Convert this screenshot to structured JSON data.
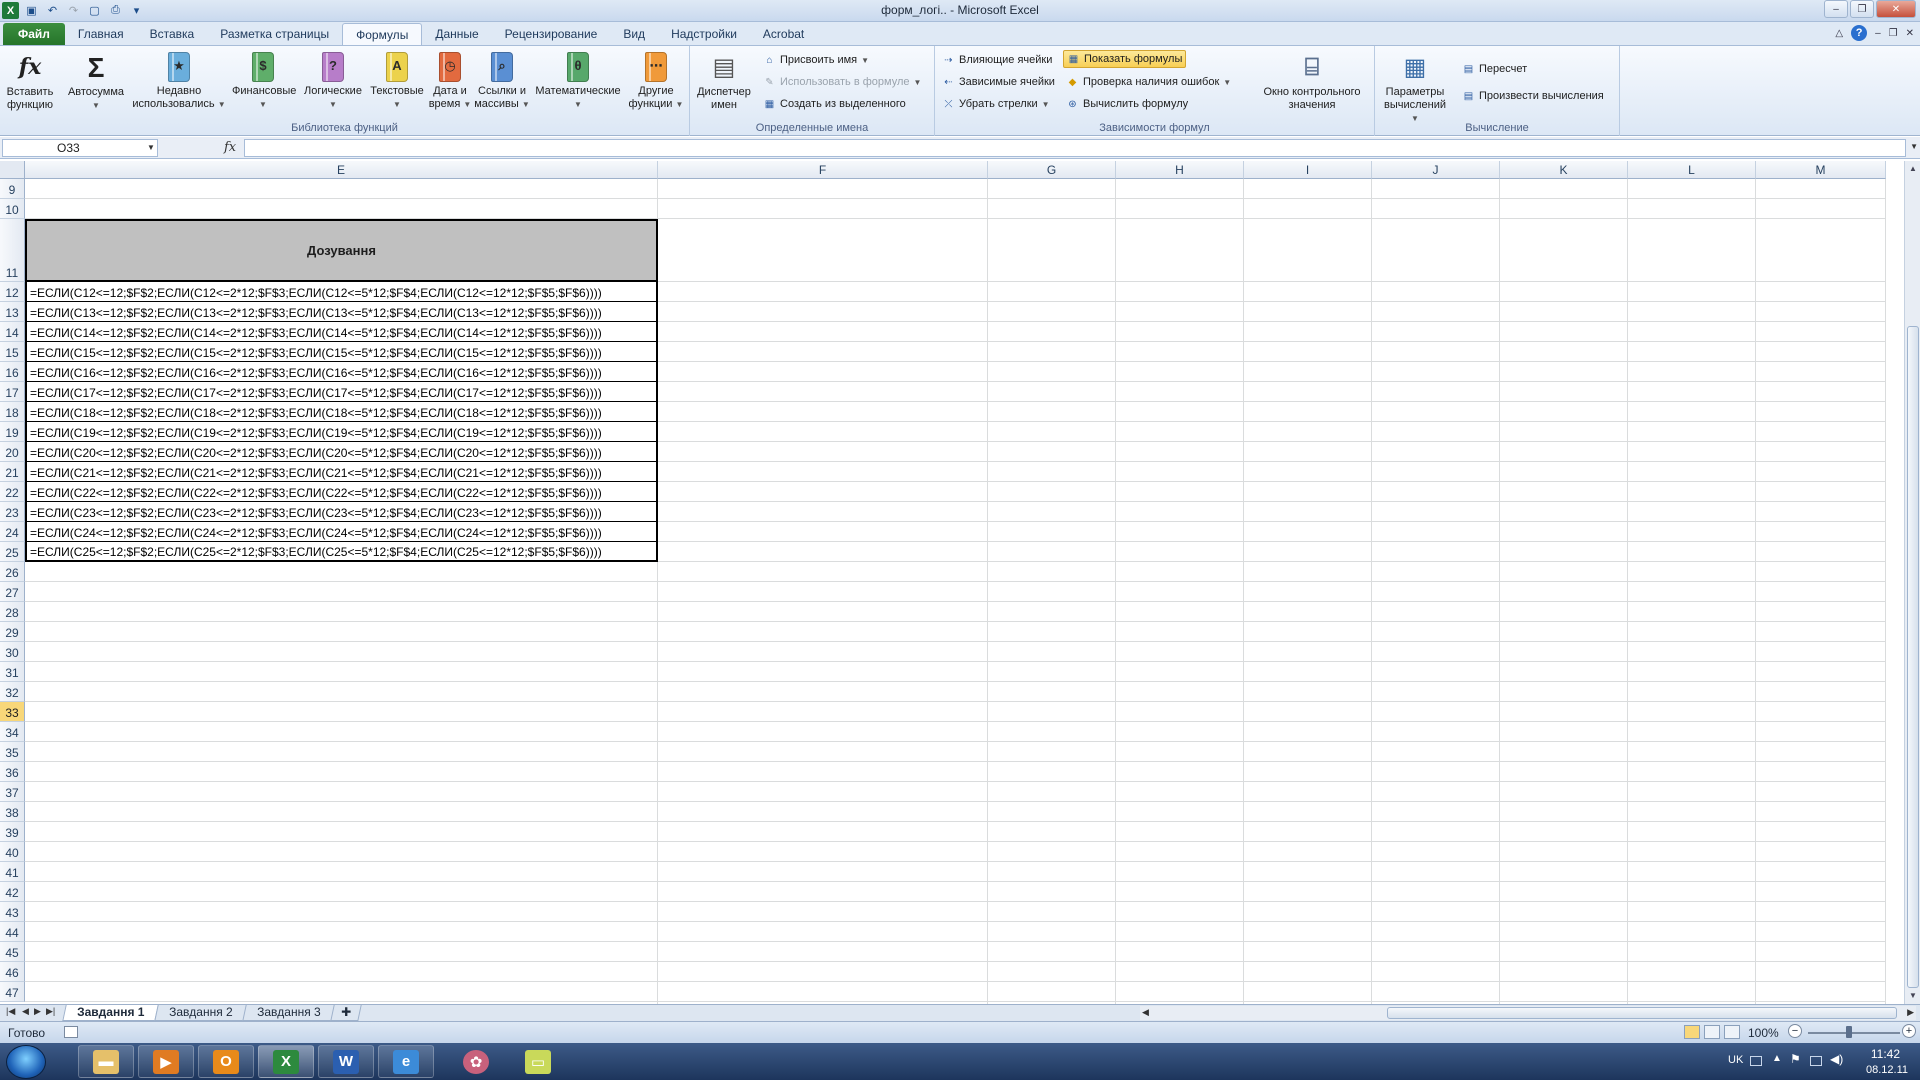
{
  "app": {
    "title": "форм_логі.. - Microsoft Excel",
    "colors": {
      "file_tab": "#2e7d32",
      "selected_row": "#f8d779",
      "header_fill": "#c0c0c0"
    }
  },
  "ribbon": {
    "tabs": [
      "Главная",
      "Вставка",
      "Разметка страницы",
      "Формулы",
      "Данные",
      "Рецензирование",
      "Вид",
      "Надстройки",
      "Acrobat"
    ],
    "file_tab": "Файл",
    "active_tab": "Формулы",
    "groups": {
      "library": {
        "label": "Библиотека функций",
        "insert_function": "Вставить функцию",
        "autosum": "Автосумма",
        "recent": "Недавно использовались",
        "financial": "Финансовые",
        "logical": "Логические",
        "text": "Текстовые",
        "datetime": "Дата и время",
        "lookup": "Ссылки и массивы",
        "math": "Математические",
        "other": "Другие функции"
      },
      "names": {
        "label": "Определенные имена",
        "manager": "Диспетчер имен",
        "define_name": "Присвоить имя",
        "use_in_formula": "Использовать в формуле",
        "create_from_selection": "Создать из выделенного"
      },
      "auditing": {
        "label": "Зависимости формул",
        "trace_precedents": "Влияющие ячейки",
        "trace_dependents": "Зависимые ячейки",
        "remove_arrows": "Убрать стрелки",
        "show_formulas": "Показать формулы",
        "error_checking": "Проверка наличия ошибок",
        "evaluate_formula": "Вычислить формулу",
        "watch_window": "Окно контрольного значения"
      },
      "calculation": {
        "label": "Вычисление",
        "options": "Параметры вычислений",
        "calc_now": "Пересчет",
        "calc_sheet": "Произвести вычисления"
      }
    }
  },
  "formula_bar": {
    "name_box": "O33",
    "fx": "fx",
    "value": ""
  },
  "grid": {
    "columns": [
      "E",
      "F",
      "G",
      "H",
      "I",
      "J",
      "K",
      "L",
      "M"
    ],
    "rows": [
      "9",
      "10",
      "11",
      "12",
      "13",
      "14",
      "15",
      "16",
      "17",
      "18",
      "19",
      "20",
      "21",
      "22",
      "23",
      "24",
      "25",
      "26",
      "27",
      "28",
      "29",
      "30",
      "31",
      "32",
      "33",
      "34",
      "35",
      "36",
      "37",
      "38",
      "39",
      "40",
      "41",
      "42",
      "43",
      "44",
      "45",
      "46",
      "47"
    ],
    "selected_row": "33",
    "table_header": "Дозування",
    "formulas": [
      "=ЕСЛИ(C12<=12;$F$2;ЕСЛИ(C12<=2*12;$F$3;ЕСЛИ(C12<=5*12;$F$4;ЕСЛИ(C12<=12*12;$F$5;$F$6))))",
      "=ЕСЛИ(C13<=12;$F$2;ЕСЛИ(C13<=2*12;$F$3;ЕСЛИ(C13<=5*12;$F$4;ЕСЛИ(C13<=12*12;$F$5;$F$6))))",
      "=ЕСЛИ(C14<=12;$F$2;ЕСЛИ(C14<=2*12;$F$3;ЕСЛИ(C14<=5*12;$F$4;ЕСЛИ(C14<=12*12;$F$5;$F$6))))",
      "=ЕСЛИ(C15<=12;$F$2;ЕСЛИ(C15<=2*12;$F$3;ЕСЛИ(C15<=5*12;$F$4;ЕСЛИ(C15<=12*12;$F$5;$F$6))))",
      "=ЕСЛИ(C16<=12;$F$2;ЕСЛИ(C16<=2*12;$F$3;ЕСЛИ(C16<=5*12;$F$4;ЕСЛИ(C16<=12*12;$F$5;$F$6))))",
      "=ЕСЛИ(C17<=12;$F$2;ЕСЛИ(C17<=2*12;$F$3;ЕСЛИ(C17<=5*12;$F$4;ЕСЛИ(C17<=12*12;$F$5;$F$6))))",
      "=ЕСЛИ(C18<=12;$F$2;ЕСЛИ(C18<=2*12;$F$3;ЕСЛИ(C18<=5*12;$F$4;ЕСЛИ(C18<=12*12;$F$5;$F$6))))",
      "=ЕСЛИ(C19<=12;$F$2;ЕСЛИ(C19<=2*12;$F$3;ЕСЛИ(C19<=5*12;$F$4;ЕСЛИ(C19<=12*12;$F$5;$F$6))))",
      "=ЕСЛИ(C20<=12;$F$2;ЕСЛИ(C20<=2*12;$F$3;ЕСЛИ(C20<=5*12;$F$4;ЕСЛИ(C20<=12*12;$F$5;$F$6))))",
      "=ЕСЛИ(C21<=12;$F$2;ЕСЛИ(C21<=2*12;$F$3;ЕСЛИ(C21<=5*12;$F$4;ЕСЛИ(C21<=12*12;$F$5;$F$6))))",
      "=ЕСЛИ(C22<=12;$F$2;ЕСЛИ(C22<=2*12;$F$3;ЕСЛИ(C22<=5*12;$F$4;ЕСЛИ(C22<=12*12;$F$5;$F$6))))",
      "=ЕСЛИ(C23<=12;$F$2;ЕСЛИ(C23<=2*12;$F$3;ЕСЛИ(C23<=5*12;$F$4;ЕСЛИ(C23<=12*12;$F$5;$F$6))))",
      "=ЕСЛИ(C24<=12;$F$2;ЕСЛИ(C24<=2*12;$F$3;ЕСЛИ(C24<=5*12;$F$4;ЕСЛИ(C24<=12*12;$F$5;$F$6))))",
      "=ЕСЛИ(C25<=12;$F$2;ЕСЛИ(C25<=2*12;$F$3;ЕСЛИ(C25<=5*12;$F$4;ЕСЛИ(C25<=12*12;$F$5;$F$6))))"
    ]
  },
  "sheets": {
    "tabs": [
      "Завдання 1",
      "Завдання 2",
      "Завдання 3"
    ],
    "active": "Завдання 1"
  },
  "status": {
    "ready": "Готово",
    "zoom": "100%"
  },
  "taskbar": {
    "lang": "UK",
    "time": "11:42",
    "date": "08.12.11"
  }
}
